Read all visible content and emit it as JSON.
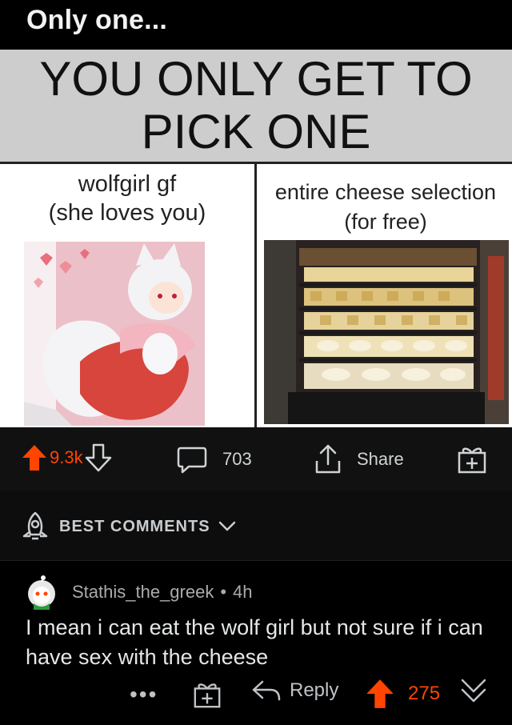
{
  "post": {
    "title": "Only one...",
    "meme_header": "YOU ONLY GET TO PICK ONE",
    "left_caption": "wolfgirl gf\n(she loves you)",
    "right_caption": "entire cheese selection (for free)"
  },
  "actions": {
    "upvotes": "9.3k",
    "comments": "703",
    "share_label": "Share"
  },
  "sort": {
    "label": "BEST COMMENTS"
  },
  "comment": {
    "username": "Stathis_the_greek",
    "separator": "•",
    "time": "4h",
    "body": "I mean i can eat the wolf girl but not sure if i can have sex with the cheese",
    "more_label": "•••",
    "reply_label": "Reply",
    "score": "275"
  },
  "colors": {
    "upvote": "#ff4500",
    "background": "#000000",
    "meme_header_bg": "#cdcdcd"
  }
}
